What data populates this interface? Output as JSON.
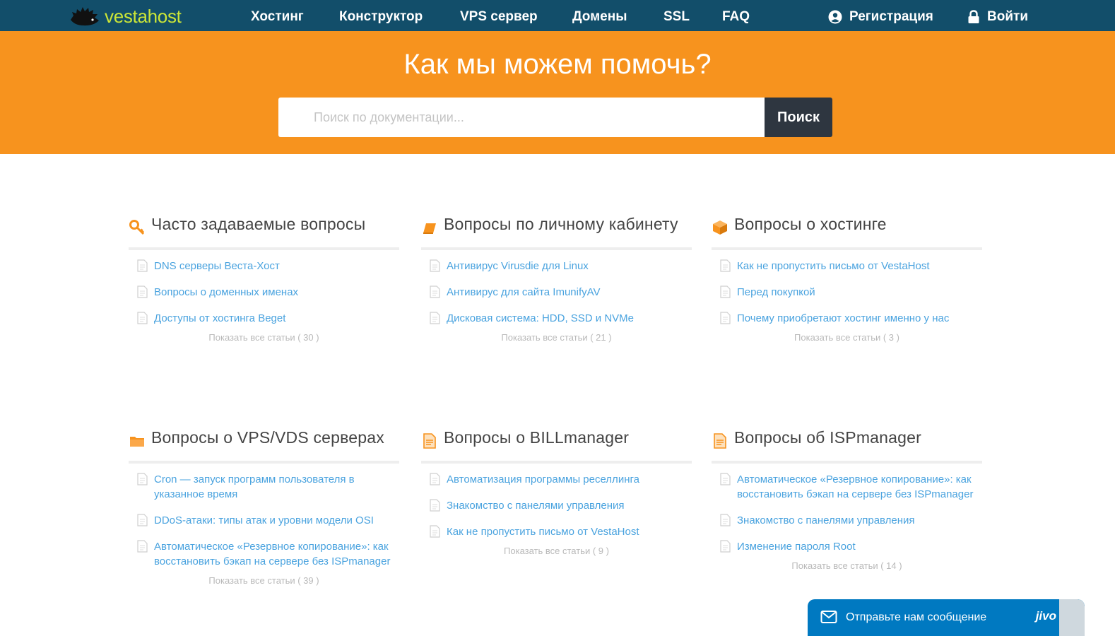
{
  "header": {
    "logo_text": "vestahost",
    "nav": [
      "Хостинг",
      "Конструктор",
      "VPS сервер",
      "Домены",
      "SSL",
      "FAQ"
    ],
    "register_label": "Регистрация",
    "login_label": "Войти"
  },
  "hero": {
    "title": "Как мы можем помочь?",
    "search_placeholder": "Поиск по документации...",
    "search_button": "Поиск"
  },
  "categories": [
    {
      "title": "Часто задаваемые вопросы",
      "icon": "key-icon",
      "articles": [
        "DNS серверы Веста-Хост",
        "Вопросы о доменных именах",
        "Доступы от хостинга Beget"
      ],
      "show_all": "Показать все статьи ( 30 )"
    },
    {
      "title": "Вопросы по личному кабинету",
      "icon": "book-icon",
      "articles": [
        "Антивирус Virusdie для Linux",
        "Антивирус для сайта ImunifyAV",
        "Дисковая система: HDD, SSD и NVMe"
      ],
      "show_all": "Показать все статьи ( 21 )"
    },
    {
      "title": "Вопросы о хостинге",
      "icon": "box-icon",
      "articles": [
        "Как не пропустить письмо от VestaHost",
        "Перед покупкой",
        "Почему приобретают хостинг именно у нас"
      ],
      "show_all": "Показать все статьи ( 3 )"
    },
    {
      "title": "Вопросы о VPS/VDS серверах",
      "icon": "folder-icon",
      "articles": [
        "Cron — запуск программ пользователя в указанное время",
        "DDoS-атаки: типы атак и уровни модели OSI",
        "Автоматическое «Резервное копирование»: как восстановить бэкап на сервере без ISPmanager"
      ],
      "show_all": "Показать все статьи ( 39 )"
    },
    {
      "title": "Вопросы о BILLmanager",
      "icon": "document-icon",
      "articles": [
        "Автоматизация программы реселлинга",
        "Знакомство с панелями управления",
        "Как не пропустить письмо от VestaHost"
      ],
      "show_all": "Показать все статьи ( 9 )"
    },
    {
      "title": "Вопросы об ISPmanager",
      "icon": "document-icon",
      "articles": [
        "Автоматическое «Резервное копирование»: как восстановить бэкап на сервере без ISPmanager",
        "Знакомство с панелями управления",
        "Изменение пароля Root"
      ],
      "show_all": "Показать все статьи ( 14 )"
    }
  ],
  "chat": {
    "label": "Отправьте нам сообщение",
    "brand": "jivo"
  },
  "colors": {
    "topbar": "#124e6a",
    "hero": "#f7931e",
    "logo_text": "#cce637",
    "link": "#4aa3df",
    "search_button": "#2e3640",
    "chat": "#0079c1"
  }
}
